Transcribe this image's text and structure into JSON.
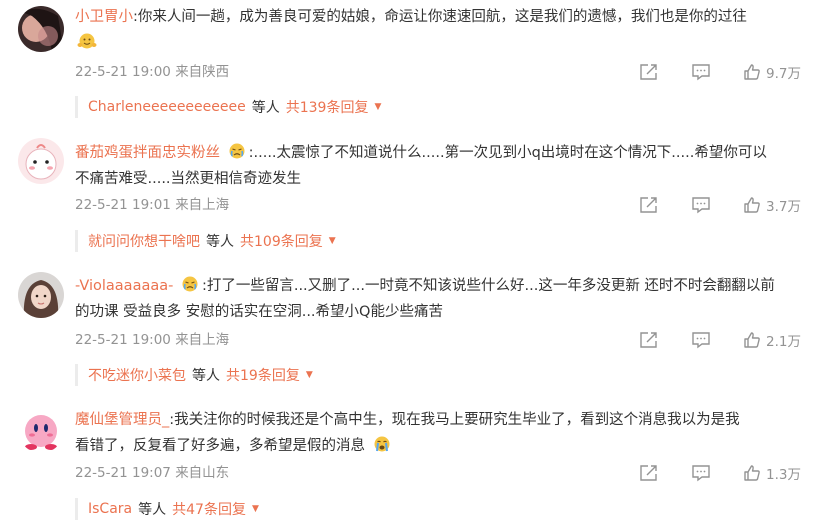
{
  "comments": [
    {
      "username": "小卫胃小",
      "text": ":你来人间一趟，成为善良可爱的姑娘，命运让你速速回航，这是我们的遗憾，我们也是你的过往",
      "emoji": "hugging-emoji",
      "date": "22-5-21 19:00",
      "location": "来自陕西",
      "likes": "9.7万",
      "reply_names": "Charleneeeeeeeeeeee",
      "reply_mid": "等人",
      "reply_count": "共139条回复"
    },
    {
      "username": "番茄鸡蛋拌面忠实粉丝",
      "text_a": ":.....太震惊了不知道说什么.....第一次见到小q出境时在这个情况下.....希望你可以",
      "text_b": "不痛苦难受.....当然更相信奇迹发生",
      "emoji": "crying-emoji",
      "date": "22-5-21 19:01",
      "location": "来自上海",
      "likes": "3.7万",
      "reply_names": "就问问你想干啥吧",
      "reply_mid": "等人",
      "reply_count": "共109条回复"
    },
    {
      "username": "-Violaaaaaaa-",
      "text_a": ":打了一些留言...又删了...一时竟不知该说些什么好...这一年多没更新 还时不时会翻翻以前",
      "text_b": "的功课 受益良多 安慰的话实在空洞...希望小Q能少些痛苦",
      "emoji": "crying-emoji",
      "date": "22-5-21 19:00",
      "location": "来自上海",
      "likes": "2.1万",
      "reply_names": "不吃迷你小菜包",
      "reply_mid": "等人",
      "reply_count": "共19条回复"
    },
    {
      "username": "魔仙堡管理员_",
      "text_a": ":我关注你的时候我还是个高中生，现在我马上要研究生毕业了，看到这个消息我以为是我",
      "text_b": "看错了，反复看了好多遍，多希望是假的消息",
      "emoji": "sob-emoji",
      "date": "22-5-21 19:07",
      "location": "来自山东",
      "likes": "1.3万",
      "reply_names": "IsCara",
      "reply_mid": "等人",
      "reply_count": "共47条回复"
    }
  ],
  "colors": {
    "username": "#eb7350",
    "text": "#333333",
    "meta": "#939393"
  }
}
